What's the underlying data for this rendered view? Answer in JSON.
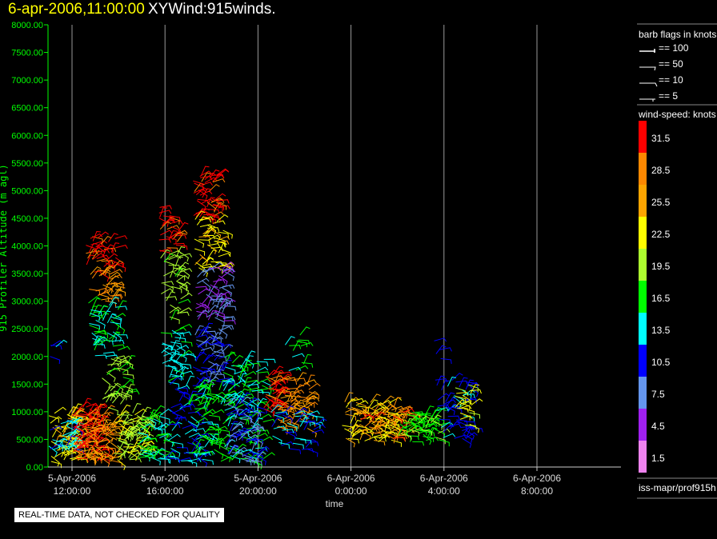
{
  "header": {
    "time": "6-apr-2006,11:00:00",
    "name": "XYWind:915winds."
  },
  "quality_note": "REAL-TIME DATA, NOT CHECKED FOR QUALITY",
  "footer_label": "iss-mapr/prof915h",
  "barb_legend": {
    "title": "barb flags in knots",
    "items": [
      "== 100",
      "== 50",
      "== 10",
      "== 5"
    ]
  },
  "colorbar": {
    "title": "wind-speed: knots",
    "labels": [
      "31.5",
      "28.5",
      "25.5",
      "22.5",
      "19.5",
      "16.5",
      "13.5",
      "10.5",
      "7.5",
      "4.5",
      "1.5"
    ],
    "colors": [
      "#ff0000",
      "#ff8800",
      "#ffa500",
      "#ffff00",
      "#adff2f",
      "#00ff00",
      "#00ffff",
      "#0000ff",
      "#6495ed",
      "#a020f0",
      "#ee82ee"
    ]
  },
  "chart_data": {
    "type": "scatter",
    "title": "XYWind:915winds.",
    "xlabel": "time",
    "ylabel": "915 Profiler Altitude (m agl)",
    "ylim": [
      0,
      8000
    ],
    "xlim_hours": [
      10.97,
      35.6
    ],
    "yticks": [
      "0.00",
      "500.00",
      "1000.00",
      "1500.00",
      "2000.00",
      "2500.00",
      "3000.00",
      "3500.00",
      "4000.00",
      "4500.00",
      "5000.00",
      "5500.00",
      "6000.00",
      "6500.00",
      "7000.00",
      "7500.00",
      "8000.00"
    ],
    "xticks": [
      {
        "h": 12,
        "date": "5-Apr-2006",
        "time": "12:00:00"
      },
      {
        "h": 16,
        "date": "5-Apr-2006",
        "time": "16:00:00"
      },
      {
        "h": 20,
        "date": "5-Apr-2006",
        "time": "20:00:00"
      },
      {
        "h": 24,
        "date": "6-Apr-2006",
        "time": "0:00:00"
      },
      {
        "h": 28,
        "date": "6-Apr-2006",
        "time": "4:00:00"
      },
      {
        "h": 32,
        "date": "6-Apr-2006",
        "time": "8:00:00"
      }
    ],
    "barb_clusters": [
      [
        11.0,
        12.3,
        100,
        1000,
        23,
        70
      ],
      [
        11.0,
        12.1,
        300,
        900,
        13,
        30
      ],
      [
        12.0,
        13.3,
        100,
        1100,
        31,
        90
      ],
      [
        12.5,
        13.8,
        100,
        1000,
        26,
        60
      ],
      [
        12.6,
        13.9,
        3500,
        4200,
        31,
        40
      ],
      [
        12.6,
        13.9,
        3000,
        3500,
        27,
        30
      ],
      [
        12.7,
        14.0,
        2000,
        3000,
        15,
        50
      ],
      [
        13.2,
        14.4,
        1000,
        2000,
        19,
        40
      ],
      [
        13.8,
        15.2,
        100,
        1000,
        20,
        80
      ],
      [
        14.8,
        16.0,
        100,
        1000,
        15,
        50
      ],
      [
        15.7,
        16.6,
        3900,
        4700,
        31,
        30
      ],
      [
        15.8,
        16.7,
        2500,
        3900,
        19,
        40
      ],
      [
        15.8,
        16.9,
        1500,
        2500,
        14,
        40
      ],
      [
        16.0,
        17.5,
        100,
        1500,
        11,
        60
      ],
      [
        17.2,
        18.3,
        4500,
        5300,
        31,
        50
      ],
      [
        17.2,
        18.5,
        3600,
        4500,
        23,
        50
      ],
      [
        17.3,
        18.6,
        2500,
        3600,
        6,
        60
      ],
      [
        17.2,
        18.6,
        1500,
        2500,
        9,
        60
      ],
      [
        17.0,
        18.5,
        100,
        1500,
        16,
        70
      ],
      [
        18.5,
        20.3,
        100,
        2000,
        15,
        110
      ],
      [
        18.6,
        20.0,
        100,
        1200,
        9,
        60
      ],
      [
        20.2,
        21.0,
        1000,
        1700,
        31,
        40
      ],
      [
        20.8,
        22.2,
        700,
        1600,
        27,
        60
      ],
      [
        20.5,
        22.5,
        300,
        1000,
        12,
        40
      ],
      [
        21.0,
        22.0,
        1700,
        2400,
        16,
        12
      ],
      [
        23.6,
        26.0,
        450,
        1200,
        24,
        100
      ],
      [
        24.3,
        26.5,
        500,
        1100,
        29,
        40
      ],
      [
        26.0,
        27.8,
        450,
        1000,
        17,
        60
      ],
      [
        27.6,
        29.2,
        500,
        1600,
        11,
        50
      ],
      [
        28.4,
        29.3,
        700,
        1500,
        22,
        20
      ],
      [
        11.0,
        11.6,
        2000,
        2300,
        11,
        4
      ],
      [
        27.5,
        27.9,
        1900,
        2300,
        10,
        4
      ]
    ]
  }
}
